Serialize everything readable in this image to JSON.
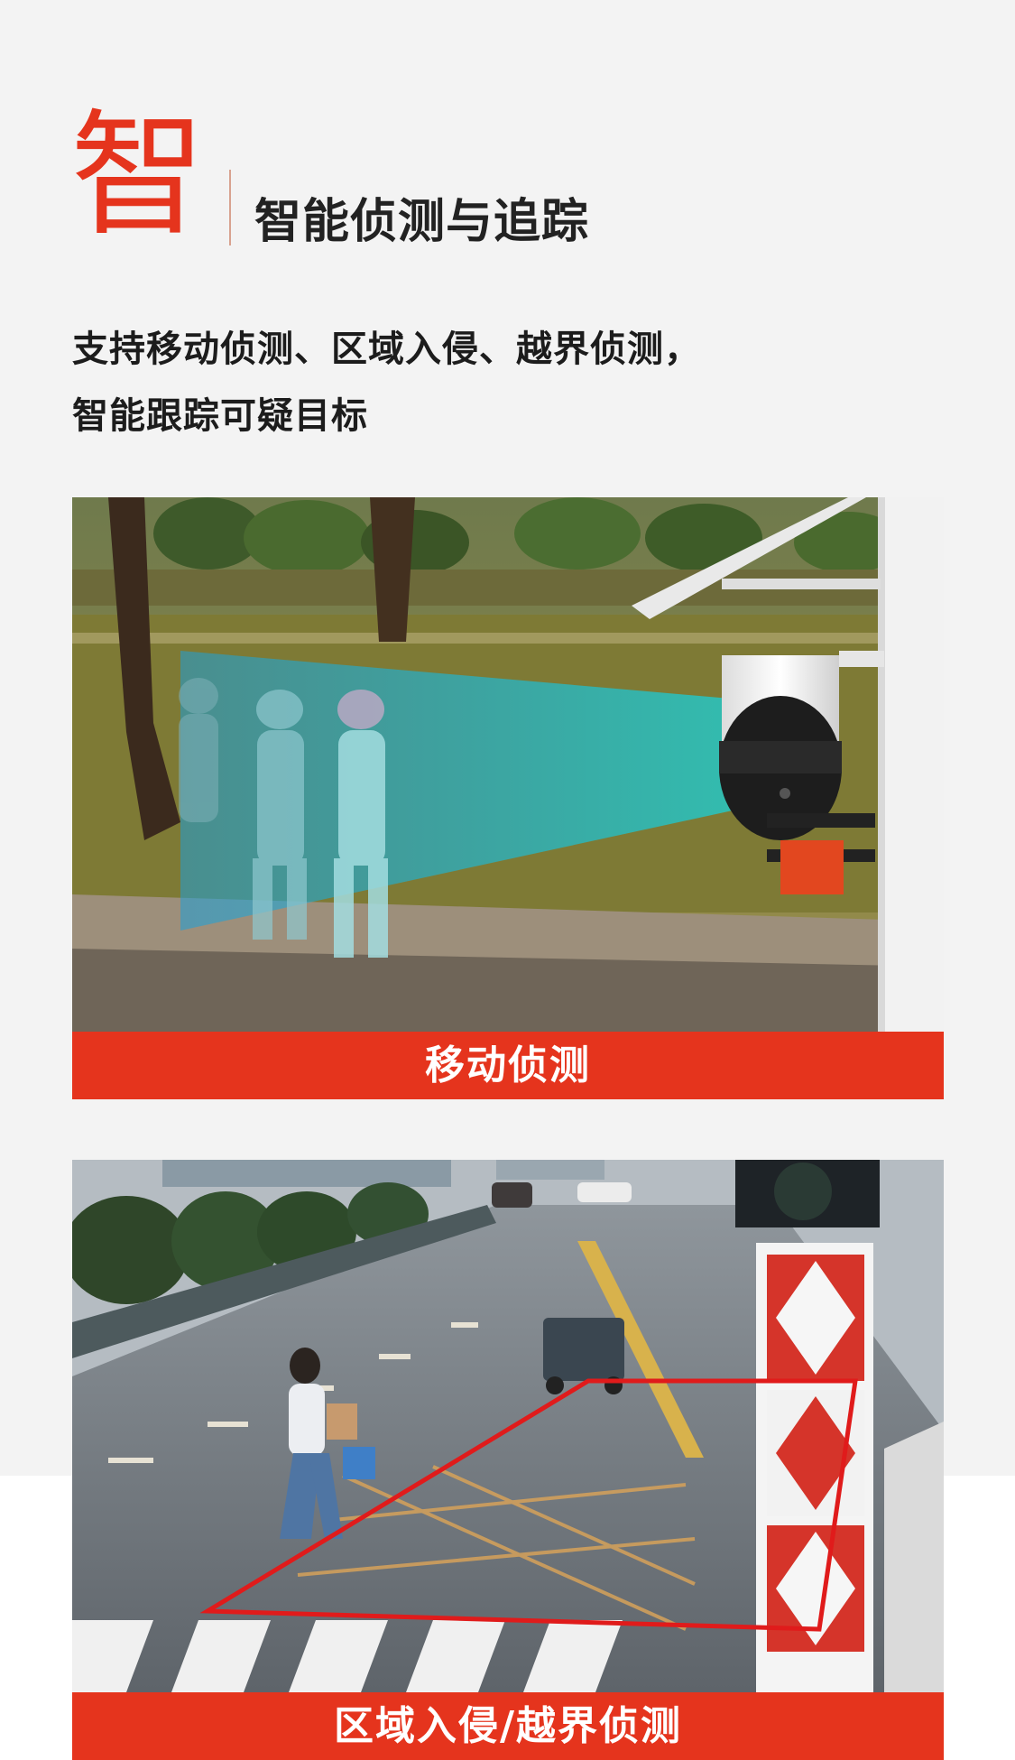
{
  "hero": {
    "char": "智",
    "heading": "智能侦测与追踪",
    "accent_color": "#e5341d"
  },
  "description": {
    "line1": "支持移动侦测、区域入侵、越界侦测，",
    "line2": "智能跟踪可疑目标"
  },
  "cards": [
    {
      "caption": "移动侦测",
      "image": "park-walkers-with-ptz-camera"
    },
    {
      "caption": "区域入侵/越界侦测",
      "image": "street-crossing-with-intrusion-zone"
    }
  ]
}
